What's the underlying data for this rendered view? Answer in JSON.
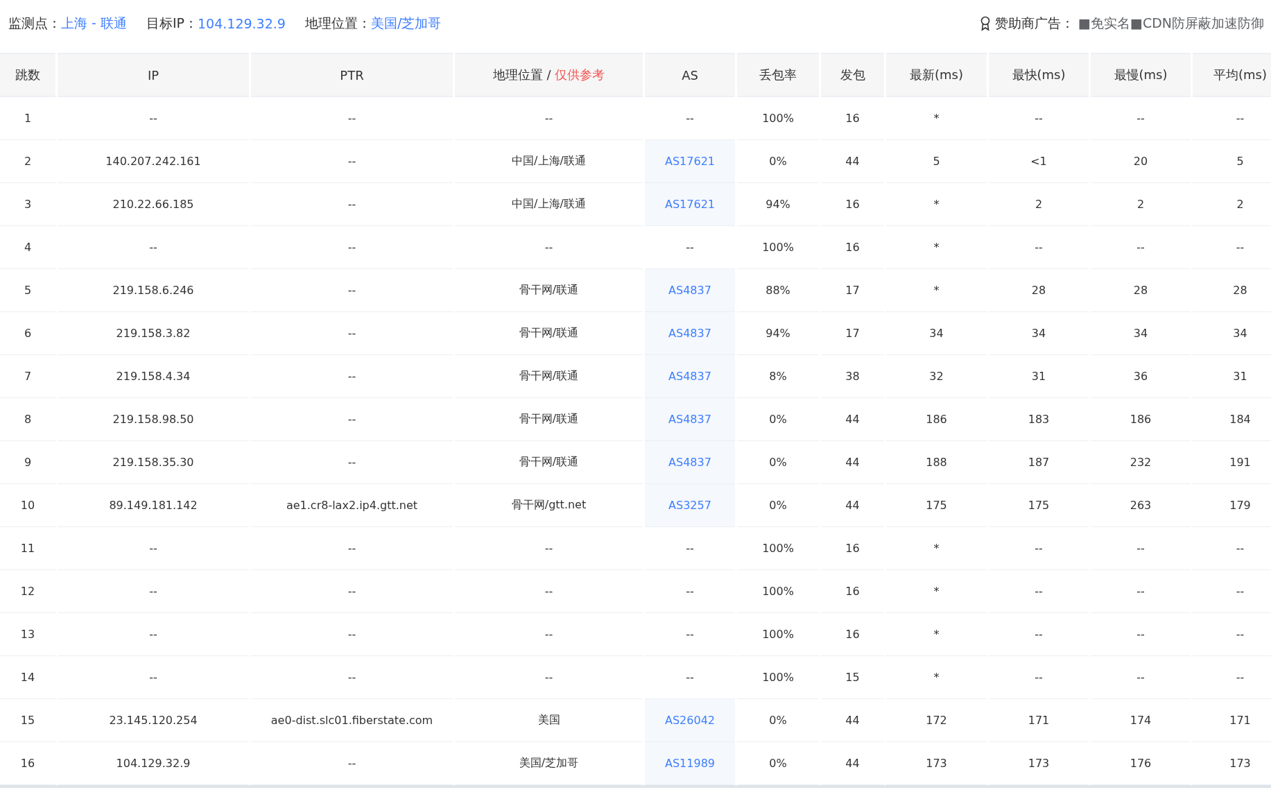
{
  "info_bar": {
    "monitor_label": "监测点：",
    "monitor_value": "上海 - 联通",
    "target_label": "目标IP：",
    "target_value": "104.129.32.9",
    "location_label": "地理位置：",
    "location_value": "美国/芝加哥",
    "sponsor_label": "赞助商广告：",
    "sponsor_text": "■免实名■CDN防屏蔽加速防御"
  },
  "table": {
    "columns": [
      {
        "label": "跳数"
      },
      {
        "label": "IP"
      },
      {
        "label": "PTR"
      },
      {
        "label": "地理位置 / ",
        "note": "仅供参考"
      },
      {
        "label": "AS"
      },
      {
        "label": "丢包率"
      },
      {
        "label": "发包"
      },
      {
        "label": "最新(ms)"
      },
      {
        "label": "最快(ms)"
      },
      {
        "label": "最慢(ms)"
      },
      {
        "label": "平均(ms)"
      }
    ],
    "rows": [
      {
        "hop": "1",
        "ip": "--",
        "ptr": "--",
        "geo": "--",
        "as": "--",
        "as_linked": false,
        "loss": "100%",
        "sent": "16",
        "last": "*",
        "best": "--",
        "worst": "--",
        "avg": "--"
      },
      {
        "hop": "2",
        "ip": "140.207.242.161",
        "ptr": "--",
        "geo": "中国/上海/联通",
        "as": "AS17621",
        "as_linked": true,
        "loss": "0%",
        "sent": "44",
        "last": "5",
        "best": "<1",
        "worst": "20",
        "avg": "5"
      },
      {
        "hop": "3",
        "ip": "210.22.66.185",
        "ptr": "--",
        "geo": "中国/上海/联通",
        "as": "AS17621",
        "as_linked": true,
        "loss": "94%",
        "sent": "16",
        "last": "*",
        "best": "2",
        "worst": "2",
        "avg": "2"
      },
      {
        "hop": "4",
        "ip": "--",
        "ptr": "--",
        "geo": "--",
        "as": "--",
        "as_linked": false,
        "loss": "100%",
        "sent": "16",
        "last": "*",
        "best": "--",
        "worst": "--",
        "avg": "--"
      },
      {
        "hop": "5",
        "ip": "219.158.6.246",
        "ptr": "--",
        "geo": "骨干网/联通",
        "as": "AS4837",
        "as_linked": true,
        "loss": "88%",
        "sent": "17",
        "last": "*",
        "best": "28",
        "worst": "28",
        "avg": "28"
      },
      {
        "hop": "6",
        "ip": "219.158.3.82",
        "ptr": "--",
        "geo": "骨干网/联通",
        "as": "AS4837",
        "as_linked": true,
        "loss": "94%",
        "sent": "17",
        "last": "34",
        "best": "34",
        "worst": "34",
        "avg": "34"
      },
      {
        "hop": "7",
        "ip": "219.158.4.34",
        "ptr": "--",
        "geo": "骨干网/联通",
        "as": "AS4837",
        "as_linked": true,
        "loss": "8%",
        "sent": "38",
        "last": "32",
        "best": "31",
        "worst": "36",
        "avg": "31"
      },
      {
        "hop": "8",
        "ip": "219.158.98.50",
        "ptr": "--",
        "geo": "骨干网/联通",
        "as": "AS4837",
        "as_linked": true,
        "loss": "0%",
        "sent": "44",
        "last": "186",
        "best": "183",
        "worst": "186",
        "avg": "184"
      },
      {
        "hop": "9",
        "ip": "219.158.35.30",
        "ptr": "--",
        "geo": "骨干网/联通",
        "as": "AS4837",
        "as_linked": true,
        "loss": "0%",
        "sent": "44",
        "last": "188",
        "best": "187",
        "worst": "232",
        "avg": "191"
      },
      {
        "hop": "10",
        "ip": "89.149.181.142",
        "ptr": "ae1.cr8-lax2.ip4.gtt.net",
        "geo": "骨干网/gtt.net",
        "as": "AS3257",
        "as_linked": true,
        "loss": "0%",
        "sent": "44",
        "last": "175",
        "best": "175",
        "worst": "263",
        "avg": "179"
      },
      {
        "hop": "11",
        "ip": "--",
        "ptr": "--",
        "geo": "--",
        "as": "--",
        "as_linked": false,
        "loss": "100%",
        "sent": "16",
        "last": "*",
        "best": "--",
        "worst": "--",
        "avg": "--"
      },
      {
        "hop": "12",
        "ip": "--",
        "ptr": "--",
        "geo": "--",
        "as": "--",
        "as_linked": false,
        "loss": "100%",
        "sent": "16",
        "last": "*",
        "best": "--",
        "worst": "--",
        "avg": "--"
      },
      {
        "hop": "13",
        "ip": "--",
        "ptr": "--",
        "geo": "--",
        "as": "--",
        "as_linked": false,
        "loss": "100%",
        "sent": "16",
        "last": "*",
        "best": "--",
        "worst": "--",
        "avg": "--"
      },
      {
        "hop": "14",
        "ip": "--",
        "ptr": "--",
        "geo": "--",
        "as": "--",
        "as_linked": false,
        "loss": "100%",
        "sent": "15",
        "last": "*",
        "best": "--",
        "worst": "--",
        "avg": "--"
      },
      {
        "hop": "15",
        "ip": "23.145.120.254",
        "ptr": "ae0-dist.slc01.fiberstate.com",
        "geo": "美国",
        "as": "AS26042",
        "as_linked": true,
        "loss": "0%",
        "sent": "44",
        "last": "172",
        "best": "171",
        "worst": "174",
        "avg": "171"
      },
      {
        "hop": "16",
        "ip": "104.129.32.9",
        "ptr": "--",
        "geo": "美国/芝加哥",
        "as": "AS11989",
        "as_linked": true,
        "loss": "0%",
        "sent": "44",
        "last": "173",
        "best": "173",
        "worst": "176",
        "avg": "173"
      }
    ]
  }
}
